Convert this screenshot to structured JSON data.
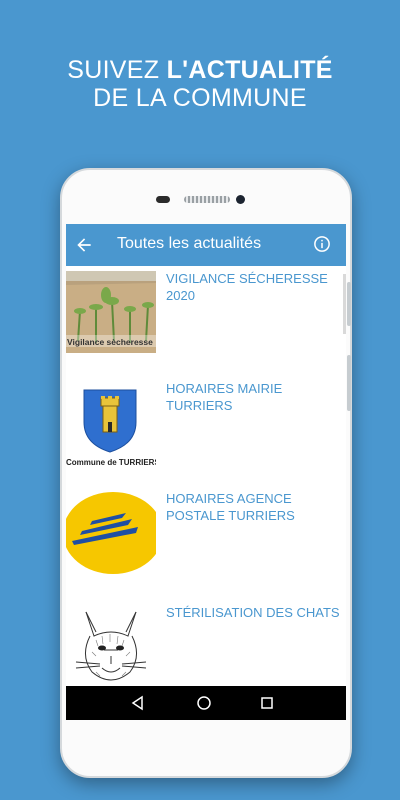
{
  "headline": {
    "line1_regular": "SUIVEZ ",
    "line1_bold": "L'ACTUALITÉ",
    "line2": "DE LA COMMUNE"
  },
  "appbar": {
    "title": "Toutes les actualités",
    "back_icon": "arrow-back-icon",
    "info_icon": "info-icon"
  },
  "news": [
    {
      "title": "VIGILANCE SÉCHERESSE 2020",
      "thumb_caption": "Vigilance sècheresse",
      "thumb_icon": "drought-field-image"
    },
    {
      "title": "HORAIRES MAIRIE TURRIERS",
      "thumb_caption": "Commune de TURRIERS",
      "thumb_icon": "coat-of-arms-image"
    },
    {
      "title": "HORAIRES AGENCE POSTALE TURRIERS",
      "thumb_icon": "la-poste-logo"
    },
    {
      "title": "STÉRILISATION DES CHATS",
      "thumb_icon": "cat-drawing-image"
    }
  ],
  "navbar": {
    "back_icon": "nav-back-triangle-icon",
    "home_icon": "nav-home-circle-icon",
    "recents_icon": "nav-recents-square-icon"
  },
  "colors": {
    "background": "#4a97cf",
    "appbar": "#4a97cf",
    "title_text": "#4a97cf",
    "poste_yellow": "#f6c700",
    "poste_blue": "#1f4fa3"
  }
}
